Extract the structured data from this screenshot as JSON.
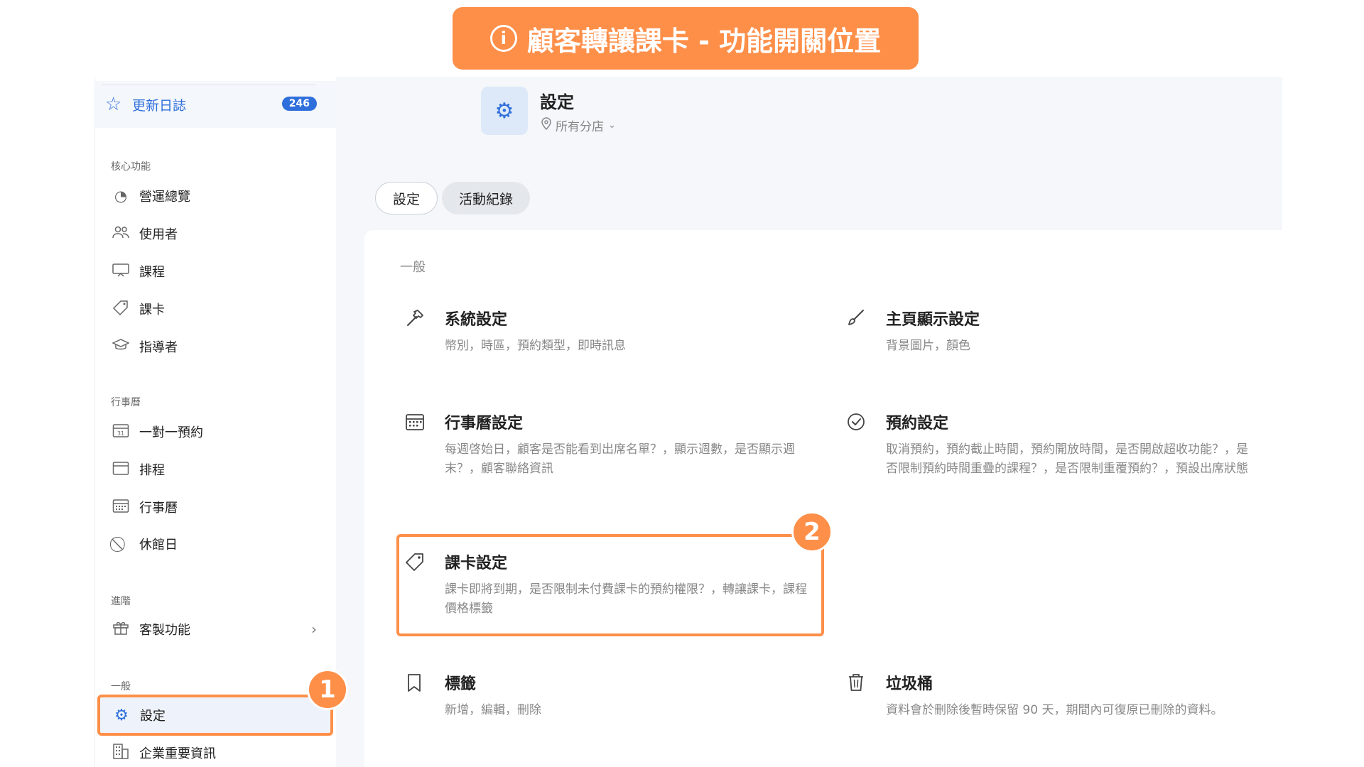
{
  "banner": {
    "icon": "info-icon",
    "text": "顧客轉讓課卡 - 功能開關位置"
  },
  "sidebar": {
    "changelog": {
      "label": "更新日誌",
      "count": "246"
    },
    "sections": {
      "core": "核心功能",
      "calendar": "行事曆",
      "advanced": "進階",
      "general": "一般"
    },
    "core_items": [
      {
        "label": "營運總覽",
        "icon": "dashboard-icon"
      },
      {
        "label": "使用者",
        "icon": "users-icon"
      },
      {
        "label": "課程",
        "icon": "course-icon"
      },
      {
        "label": "課卡",
        "icon": "tag-icon"
      },
      {
        "label": "指導者",
        "icon": "mortarboard-icon"
      }
    ],
    "calendar_items": [
      {
        "label": "一對一預約",
        "icon": "calendar-31-icon"
      },
      {
        "label": "排程",
        "icon": "calendar-icon"
      },
      {
        "label": "行事曆",
        "icon": "calendar-grid-icon"
      },
      {
        "label": "休館日",
        "icon": "prohibited-icon"
      }
    ],
    "advanced_items": [
      {
        "label": "客製功能",
        "icon": "gift-icon"
      }
    ],
    "general_items": [
      {
        "label": "設定",
        "icon": "gear-icon"
      },
      {
        "label": "企業重要資訊",
        "icon": "building-icon"
      }
    ],
    "marker": "1"
  },
  "header": {
    "title": "設定",
    "branch": "所有分店"
  },
  "tabs": [
    {
      "label": "設定",
      "active": true
    },
    {
      "label": "活動紀錄",
      "active": false
    }
  ],
  "content": {
    "group_label": "一般",
    "cards": [
      {
        "title": "系統設定",
        "desc": "幣別，時區，預約類型，即時訊息",
        "icon": "hammer-icon"
      },
      {
        "title": "主頁顯示設定",
        "desc": "背景圖片，顏色",
        "icon": "brush-icon"
      },
      {
        "title": "行事曆設定",
        "desc": "每週啓始日，顧客是否能看到出席名單？，顯示週數，是否顯示週末？，顧客聯絡資訊",
        "icon": "calendar-grid-icon"
      },
      {
        "title": "預約設定",
        "desc": "取消預約，預約截止時間，預約開放時間，是否開啟超收功能？，是否限制預約時間重疊的課程？，是否限制重覆預約？，預設出席狀態",
        "icon": "check-circle-icon"
      },
      {
        "title": "課卡設定",
        "desc": "課卡即將到期，是否限制未付費課卡的預約權限？，轉讓課卡，課程價格標籤",
        "icon": "tag-icon"
      },
      {
        "title": "標籤",
        "desc": "新增，編輯，刪除",
        "icon": "bookmark-icon"
      },
      {
        "title": "垃圾桶",
        "desc": "資料會於刪除後暫時保留 90 天，期間內可復原已刪除的資料。",
        "icon": "trash-icon"
      }
    ],
    "marker": "2"
  },
  "colors": {
    "accent": "#FE8F49",
    "primary": "#2f6fdc"
  }
}
